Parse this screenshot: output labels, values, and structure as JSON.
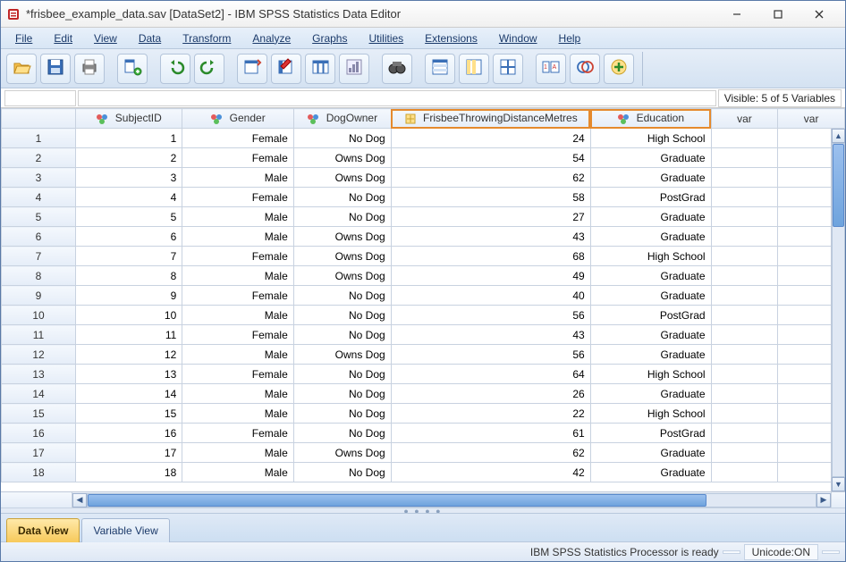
{
  "window": {
    "title": "*frisbee_example_data.sav [DataSet2] - IBM SPSS Statistics Data Editor"
  },
  "menu": [
    "File",
    "Edit",
    "View",
    "Data",
    "Transform",
    "Analyze",
    "Graphs",
    "Utilities",
    "Extensions",
    "Window",
    "Help"
  ],
  "info": {
    "visible_text": "Visible: 5 of 5 Variables"
  },
  "columns": {
    "subject": "SubjectID",
    "gender": "Gender",
    "dogowner": "DogOwner",
    "frisbee": "FrisbeeThrowingDistanceMetres",
    "education": "Education",
    "var": "var"
  },
  "rows": [
    {
      "n": "1",
      "SubjectID": "1",
      "Gender": "Female",
      "DogOwner": "No Dog",
      "Frisbee": "24",
      "Education": "High School"
    },
    {
      "n": "2",
      "SubjectID": "2",
      "Gender": "Female",
      "DogOwner": "Owns Dog",
      "Frisbee": "54",
      "Education": "Graduate"
    },
    {
      "n": "3",
      "SubjectID": "3",
      "Gender": "Male",
      "DogOwner": "Owns Dog",
      "Frisbee": "62",
      "Education": "Graduate"
    },
    {
      "n": "4",
      "SubjectID": "4",
      "Gender": "Female",
      "DogOwner": "No Dog",
      "Frisbee": "58",
      "Education": "PostGrad"
    },
    {
      "n": "5",
      "SubjectID": "5",
      "Gender": "Male",
      "DogOwner": "No Dog",
      "Frisbee": "27",
      "Education": "Graduate"
    },
    {
      "n": "6",
      "SubjectID": "6",
      "Gender": "Male",
      "DogOwner": "Owns Dog",
      "Frisbee": "43",
      "Education": "Graduate"
    },
    {
      "n": "7",
      "SubjectID": "7",
      "Gender": "Female",
      "DogOwner": "Owns Dog",
      "Frisbee": "68",
      "Education": "High School"
    },
    {
      "n": "8",
      "SubjectID": "8",
      "Gender": "Male",
      "DogOwner": "Owns Dog",
      "Frisbee": "49",
      "Education": "Graduate"
    },
    {
      "n": "9",
      "SubjectID": "9",
      "Gender": "Female",
      "DogOwner": "No Dog",
      "Frisbee": "40",
      "Education": "Graduate"
    },
    {
      "n": "10",
      "SubjectID": "10",
      "Gender": "Male",
      "DogOwner": "No Dog",
      "Frisbee": "56",
      "Education": "PostGrad"
    },
    {
      "n": "11",
      "SubjectID": "11",
      "Gender": "Female",
      "DogOwner": "No Dog",
      "Frisbee": "43",
      "Education": "Graduate"
    },
    {
      "n": "12",
      "SubjectID": "12",
      "Gender": "Male",
      "DogOwner": "Owns Dog",
      "Frisbee": "56",
      "Education": "Graduate"
    },
    {
      "n": "13",
      "SubjectID": "13",
      "Gender": "Female",
      "DogOwner": "No Dog",
      "Frisbee": "64",
      "Education": "High School"
    },
    {
      "n": "14",
      "SubjectID": "14",
      "Gender": "Male",
      "DogOwner": "No Dog",
      "Frisbee": "26",
      "Education": "Graduate"
    },
    {
      "n": "15",
      "SubjectID": "15",
      "Gender": "Male",
      "DogOwner": "No Dog",
      "Frisbee": "22",
      "Education": "High School"
    },
    {
      "n": "16",
      "SubjectID": "16",
      "Gender": "Female",
      "DogOwner": "No Dog",
      "Frisbee": "61",
      "Education": "PostGrad"
    },
    {
      "n": "17",
      "SubjectID": "17",
      "Gender": "Male",
      "DogOwner": "Owns Dog",
      "Frisbee": "62",
      "Education": "Graduate"
    },
    {
      "n": "18",
      "SubjectID": "18",
      "Gender": "Male",
      "DogOwner": "No Dog",
      "Frisbee": "42",
      "Education": "Graduate"
    }
  ],
  "tabs": {
    "data_view": "Data View",
    "variable_view": "Variable View"
  },
  "status": {
    "processor": "IBM SPSS Statistics Processor is ready",
    "unicode": "Unicode:ON"
  }
}
